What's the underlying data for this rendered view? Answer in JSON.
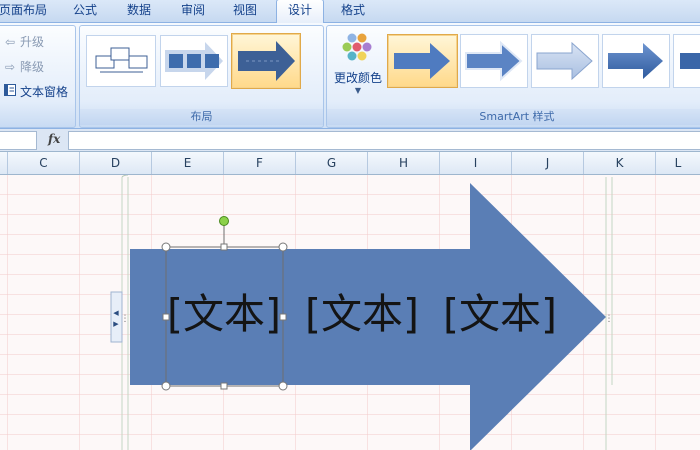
{
  "tabs": [
    {
      "label": "页面布局",
      "active": false
    },
    {
      "label": "公式",
      "active": false
    },
    {
      "label": "数据",
      "active": false
    },
    {
      "label": "审阅",
      "active": false
    },
    {
      "label": "视图",
      "active": false
    },
    {
      "label": "设计",
      "active": true
    },
    {
      "label": "格式",
      "active": false
    }
  ],
  "create_graphic": {
    "promote": "升级",
    "demote": "降级",
    "text_pane": "文本窗格"
  },
  "layouts": {
    "group_label": "布局"
  },
  "styles": {
    "change_colors": "更改颜色",
    "group_label": "SmartArt 样式"
  },
  "formula_bar": {
    "fx_label": "fx",
    "value": ""
  },
  "columns": [
    "C",
    "D",
    "E",
    "F",
    "G",
    "H",
    "I",
    "J",
    "K",
    "L"
  ],
  "smartart": {
    "items": [
      "[文本]",
      "[文本]",
      "[文本]"
    ]
  },
  "colors": {
    "arrow_fill": "#5a7eb5",
    "ribbon_bg": "#dce8f7",
    "selection_gold": "#f6c343",
    "grid_line": "#f1c8c8"
  }
}
